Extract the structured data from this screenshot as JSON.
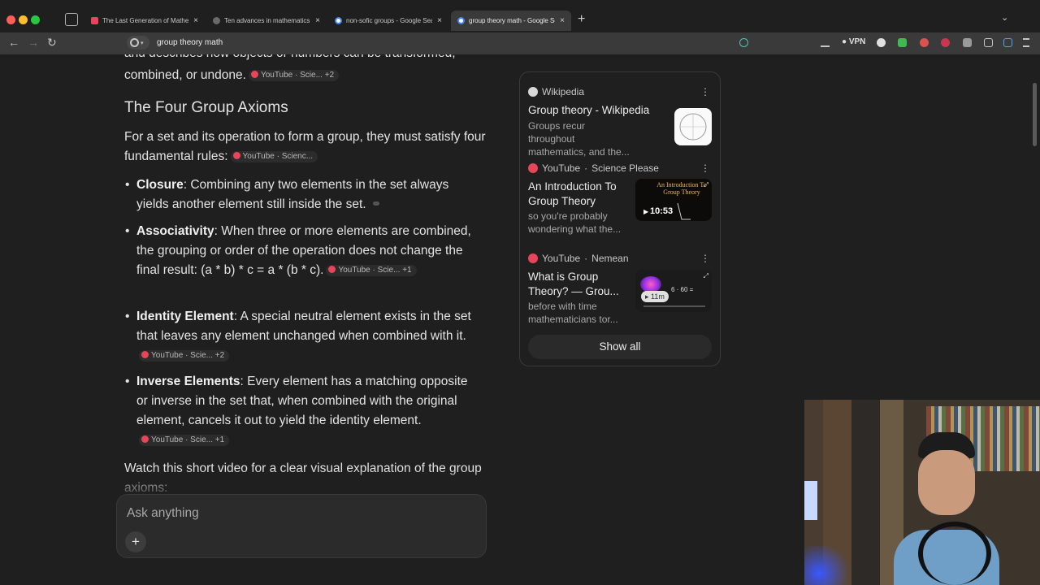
{
  "tabs": [
    {
      "title": "The Last Generation of Mathem",
      "favicon": "youtube-icon",
      "active": false
    },
    {
      "title": "Ten advances in mathematics a",
      "favicon": "page-icon",
      "active": false
    },
    {
      "title": "non-sofic groups - Google Sear",
      "favicon": "google-icon",
      "active": false
    },
    {
      "title": "group theory math - Google Sea",
      "favicon": "google-icon",
      "active": true
    }
  ],
  "address": {
    "url": "group theory math"
  },
  "toolbar": {
    "vpn_label": "VPN"
  },
  "content": {
    "cut_line": "and describes how objects or numbers can be transformed,",
    "intro_end": "combined, or undone.",
    "intro_chip": "YouTube · Scie... +2",
    "heading": "The Four Group Axioms",
    "lead": "For a set and its operation to form a group, they must satisfy four fundamental rules:",
    "lead_chip": "YouTube · Scienc...",
    "axioms": [
      {
        "name": "Closure",
        "text": ": Combining any two elements in the set always yields another element still inside the set.",
        "chip": ""
      },
      {
        "name": "Associativity",
        "text": ": When three or more elements are combined, the grouping or order of the operation does not change the final result: (a * b) * c = a * (b * c).",
        "chip": "YouTube · Scie... +1"
      },
      {
        "name": "Identity Element",
        "text": ": A special neutral element exists in the set that leaves any element unchanged when combined with it.",
        "chip": "YouTube · Scie... +2"
      },
      {
        "name": "Inverse Elements",
        "text": ": Every element has a matching opposite or inverse in the set that, when combined with the original element, cancels it out to yield the identity element.",
        "chip": "YouTube · Scie... +1"
      }
    ],
    "video_lead": "Watch this short video for a clear visual explanation of the group axioms:"
  },
  "ask": {
    "placeholder": "Ask anything",
    "plus": "+"
  },
  "sources": {
    "items": [
      {
        "site": "Wikipedia",
        "channel": "",
        "title": "Group theory - Wikipedia",
        "snippet": "Groups recur throughout mathematics, and the...",
        "duration": ""
      },
      {
        "site": "YouTube",
        "channel": "Science Please",
        "title": "An Introduction To Group Theory",
        "snippet": "so you're probably wondering what the...",
        "duration": "10:53",
        "thumb_text": "An Introduction To Group Theory"
      },
      {
        "site": "YouTube",
        "channel": "Nemean",
        "title": "What is Group Theory? — Grou...",
        "snippet": "before with time mathematicians tor...",
        "duration": "11m",
        "thumb_text": "6 · 60 ="
      }
    ],
    "show_all": "Show all"
  },
  "colors": {
    "background": "#1f1f1f",
    "youtube_red": "#e8455a",
    "panel_border": "#3a3a3a"
  }
}
